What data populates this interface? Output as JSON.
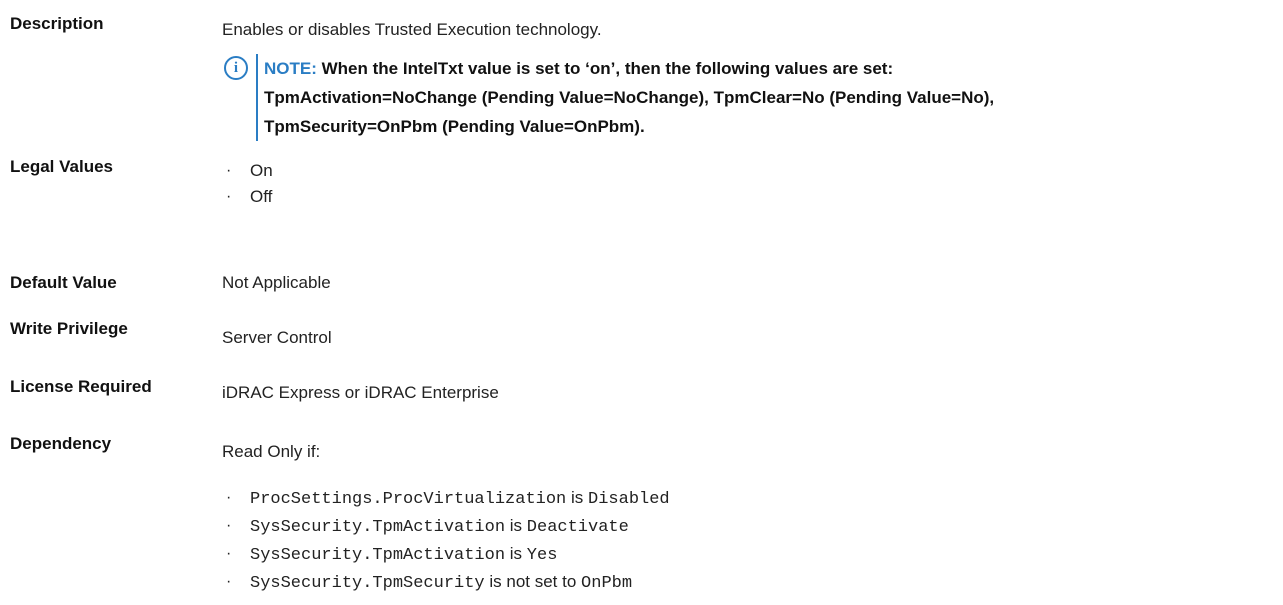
{
  "description": {
    "label": "Description",
    "text": "Enables or disables Trusted Execution technology.",
    "note_icon": "info-icon",
    "note_label": "NOTE:",
    "note_lines": [
      "When the IntelTxt value is set to ‘on’, then the following values are set:",
      "TpmActivation=NoChange (Pending Value=NoChange), TpmClear=No (Pending Value=No),",
      "TpmSecurity=OnPbm (Pending Value=OnPbm)."
    ]
  },
  "legal_values": {
    "label": "Legal Values",
    "items": [
      "On",
      "Off"
    ]
  },
  "default_value": {
    "label": "Default Value",
    "text": "Not Applicable"
  },
  "write_privilege": {
    "label": "Write Privilege",
    "text": "Server Control"
  },
  "license_required": {
    "label": "License Required",
    "text": "iDRAC Express or iDRAC Enterprise"
  },
  "dependency": {
    "label": "Dependency",
    "intro": "Read Only if:",
    "items": [
      {
        "code": "ProcSettings.ProcVirtualization",
        "connector": "is",
        "value": "Disabled"
      },
      {
        "code": "SysSecurity.TpmActivation",
        "connector": "is",
        "value": "Deactivate"
      },
      {
        "code": "SysSecurity.TpmActivation",
        "connector": "is",
        "value": "Yes"
      },
      {
        "code": "SysSecurity.TpmSecurity",
        "connector": "is not set to",
        "value": "OnPbm"
      }
    ]
  },
  "bullet_glyph": "·",
  "accent_color": "#2a7dc4"
}
